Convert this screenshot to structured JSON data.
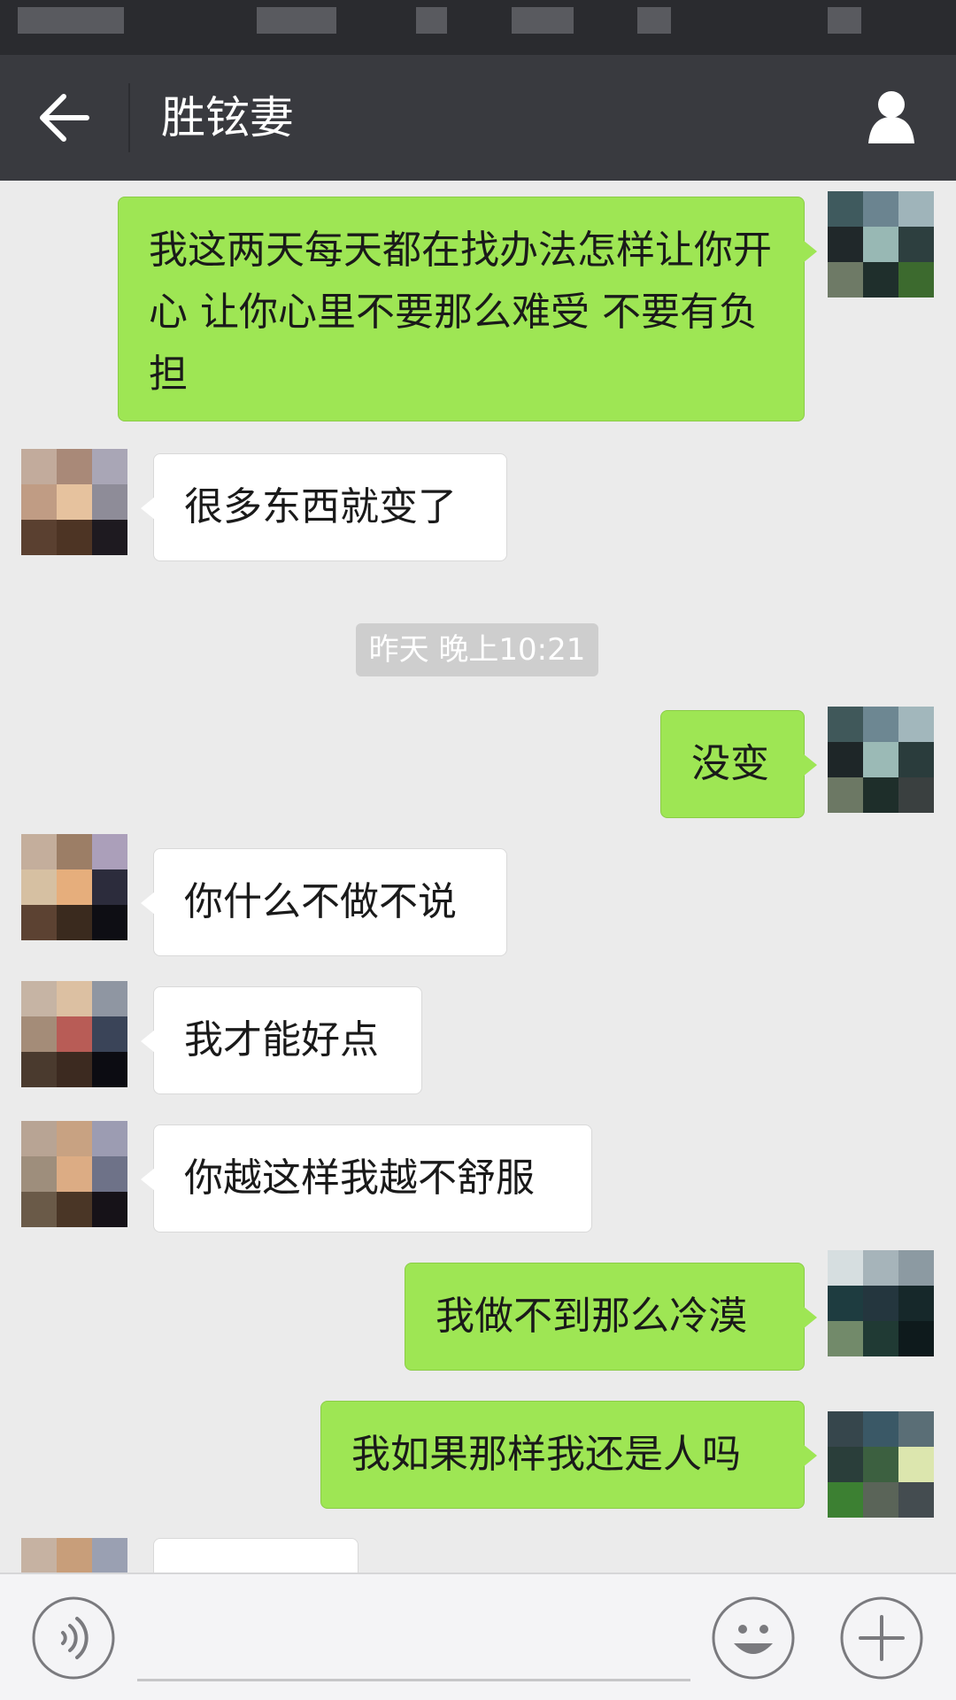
{
  "nav": {
    "title": "胜铉妻",
    "back_icon": "arrow-left-icon",
    "profile_icon": "person-icon"
  },
  "messages": [
    {
      "side": "sent",
      "text": "我这两天每天都在找办法怎样让你开心 让你心里不要那么难受  不要有负担"
    },
    {
      "side": "recv",
      "text": "很多东西就变了"
    },
    {
      "side": "time",
      "text": "昨天 晚上10:21"
    },
    {
      "side": "sent",
      "text": "没变"
    },
    {
      "side": "recv",
      "text": "你什么不做不说"
    },
    {
      "side": "recv",
      "text": "我才能好点"
    },
    {
      "side": "recv",
      "text": "你越这样我越不舒服"
    },
    {
      "side": "sent",
      "text": "我做不到那么冷漠"
    },
    {
      "side": "sent",
      "text": "我如果那样我还是人吗"
    },
    {
      "side": "recv",
      "text": ""
    }
  ],
  "input_bar": {
    "voice_icon": "voice-icon",
    "emoji_icon": "emoji-icon",
    "plus_icon": "plus-icon"
  },
  "colors": {
    "nav_bg": "#393a3f",
    "chat_bg": "#ebebeb",
    "sent_bubble": "#9ee654",
    "recv_bubble": "#ffffff"
  }
}
